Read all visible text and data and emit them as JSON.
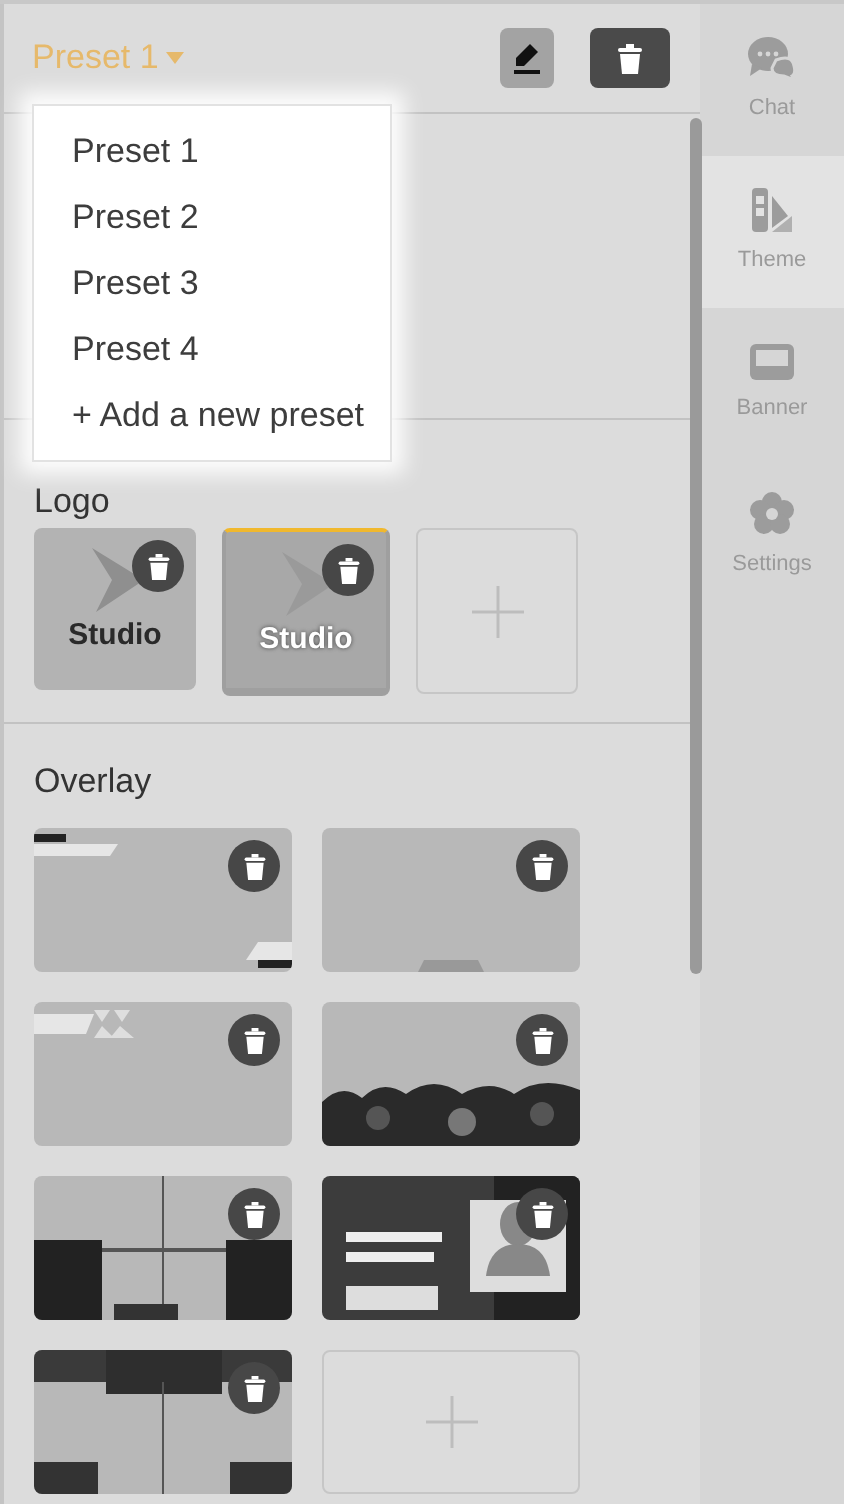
{
  "header": {
    "preset_label": "Preset 1"
  },
  "dropdown": {
    "items": [
      {
        "label": "Preset 1"
      },
      {
        "label": "Preset 2"
      },
      {
        "label": "Preset 3"
      },
      {
        "label": "Preset 4"
      },
      {
        "label": "+ Add a new preset"
      }
    ]
  },
  "logo": {
    "title": "Logo",
    "items": [
      {
        "kind": "logo",
        "text": "Studio",
        "selected": false
      },
      {
        "kind": "logo",
        "text": "Studio",
        "selected": true
      },
      {
        "kind": "add"
      }
    ]
  },
  "overlay": {
    "title": "Overlay",
    "items": [
      {
        "kind": "picture"
      },
      {
        "kind": "picture"
      },
      {
        "kind": "picture"
      },
      {
        "kind": "picture"
      },
      {
        "kind": "picture"
      },
      {
        "kind": "picture"
      },
      {
        "kind": "picture"
      },
      {
        "kind": "add"
      }
    ]
  },
  "sidebar": {
    "items": [
      {
        "label": "Chat",
        "selected": false
      },
      {
        "label": "Theme",
        "selected": true
      },
      {
        "label": "Banner",
        "selected": false
      },
      {
        "label": "Settings",
        "selected": false
      }
    ]
  }
}
